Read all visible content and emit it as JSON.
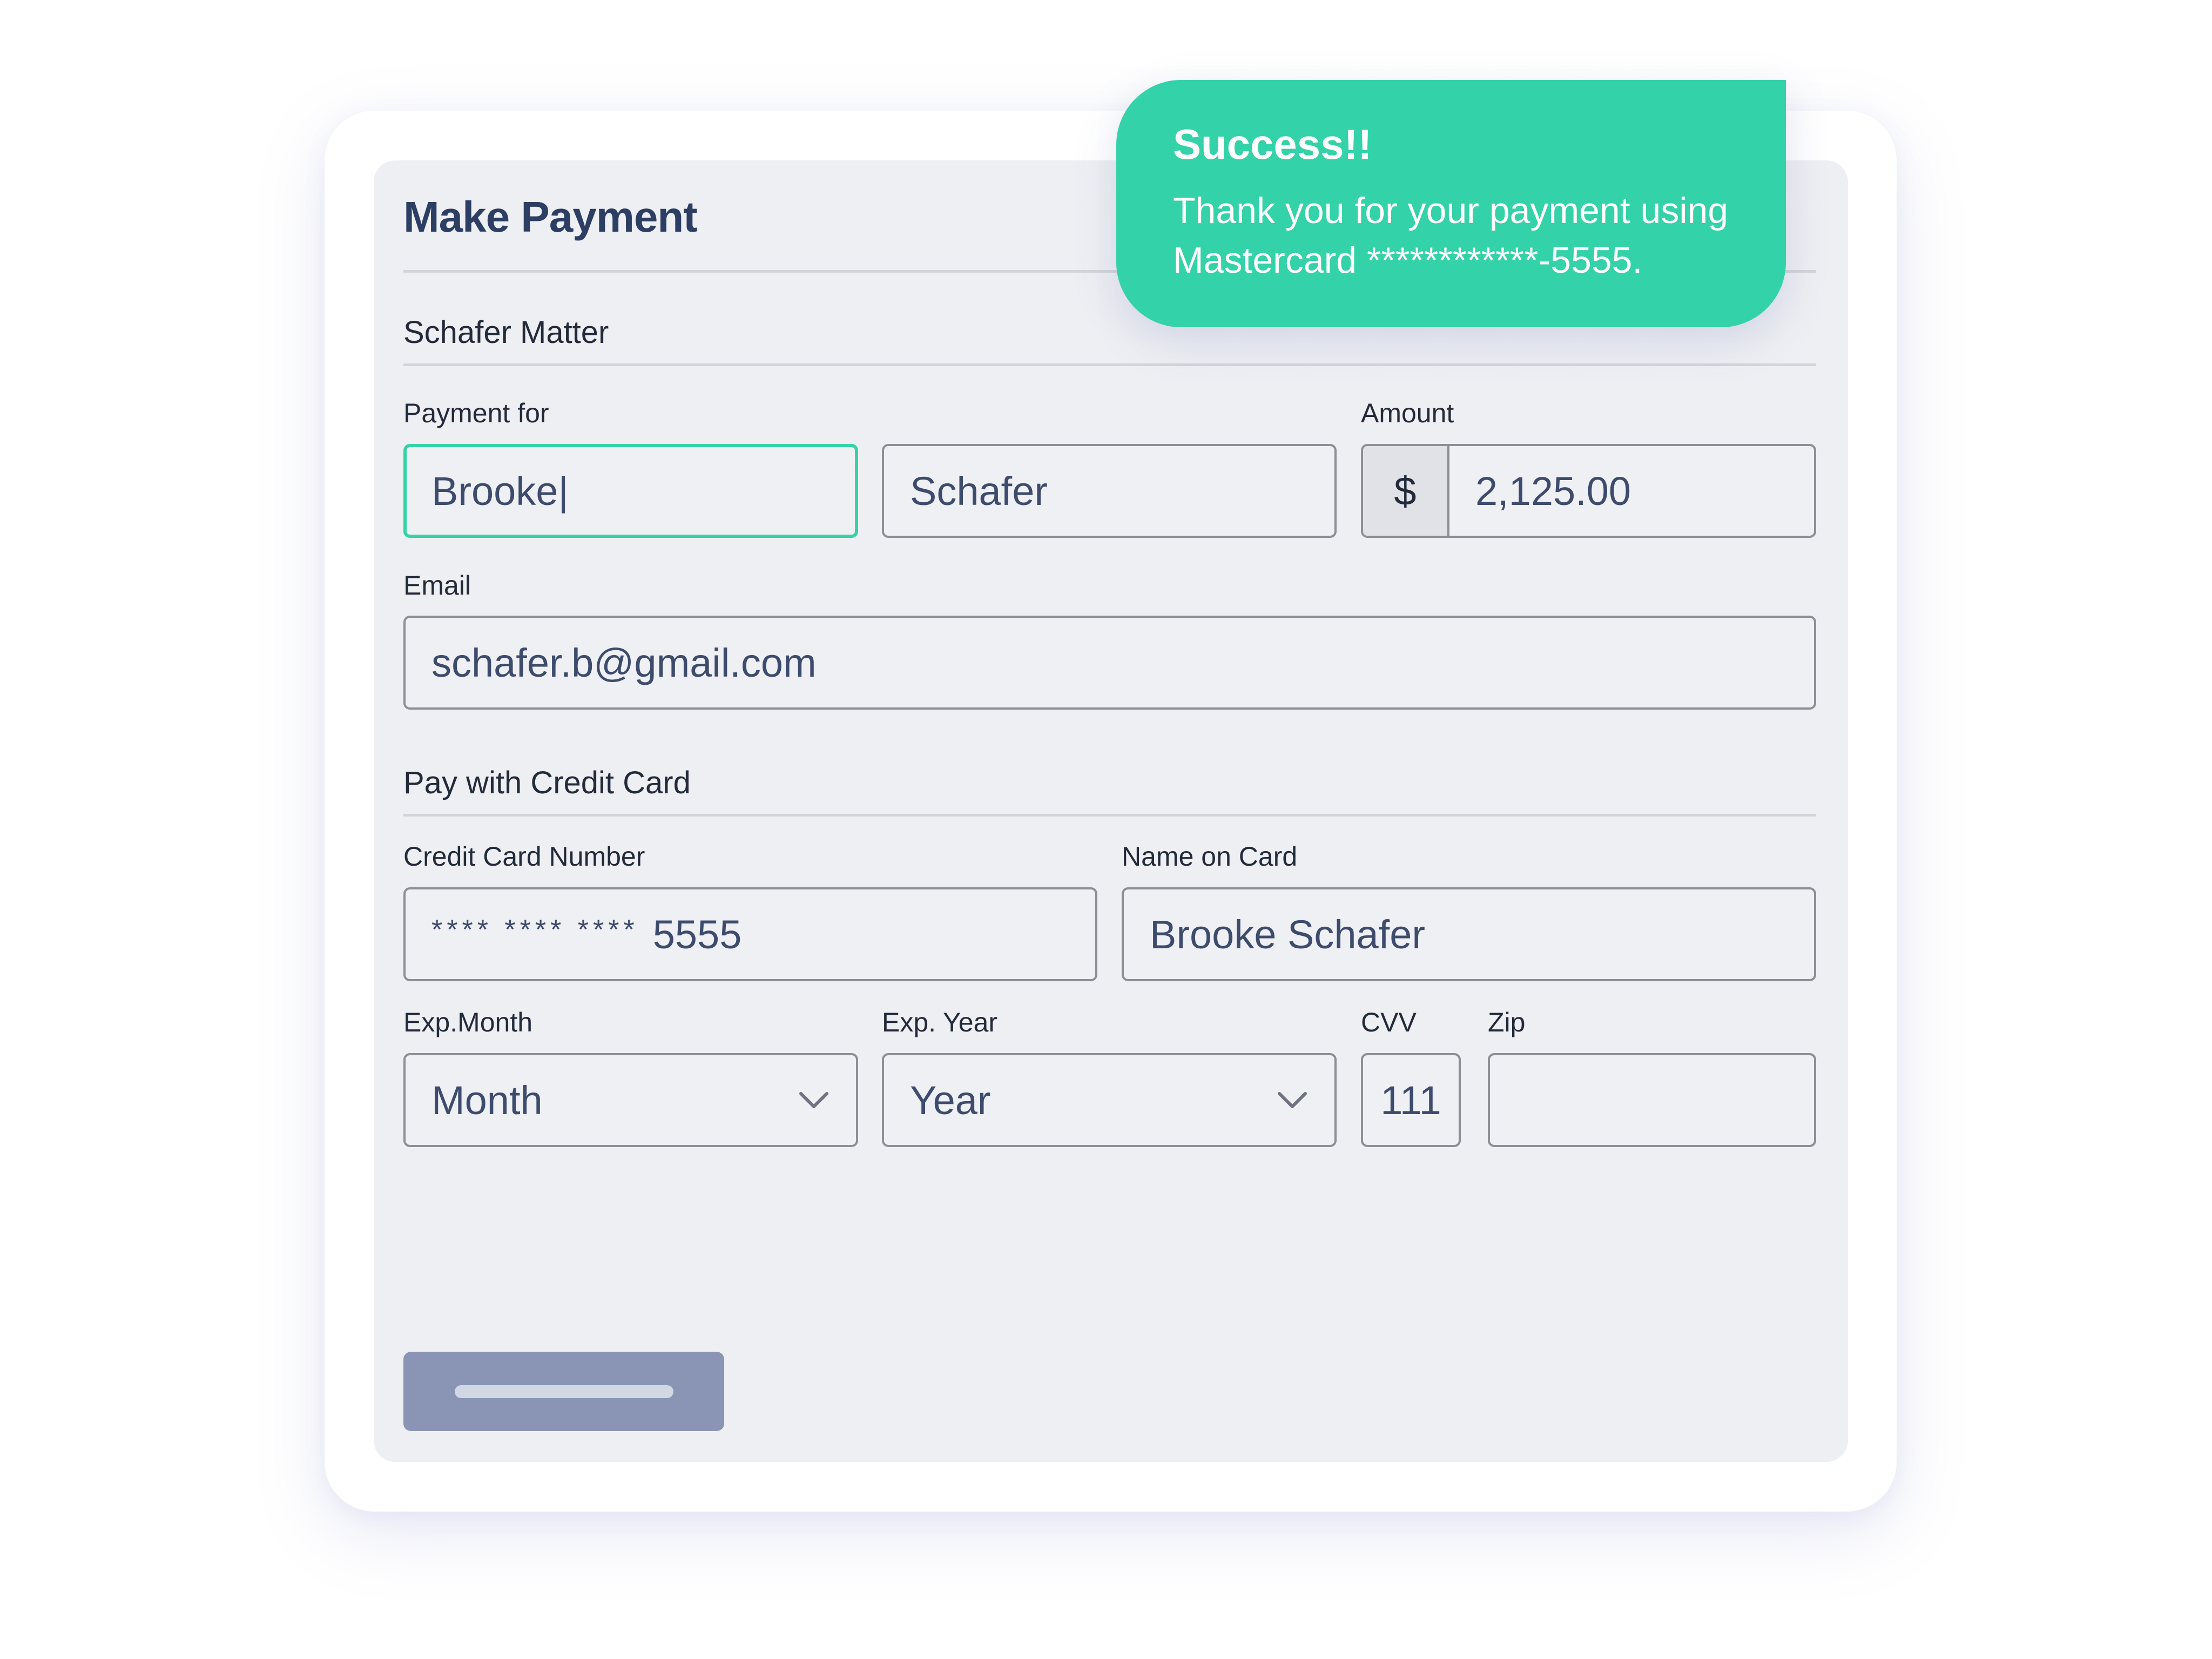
{
  "form": {
    "title": "Make Payment",
    "matter_section": "Schafer Matter",
    "payment_for_label": "Payment for",
    "first_name_value": "Brooke|",
    "last_name_value": "Schafer",
    "amount_label": "Amount",
    "currency_symbol": "$",
    "amount_value": "2,125.00",
    "email_label": "Email",
    "email_value": "schafer.b@gmail.com",
    "card_section": "Pay with Credit Card",
    "card_number_label": "Credit Card Number",
    "card_number_mask": "**** **** ****",
    "card_number_last4": "5555",
    "name_on_card_label": "Name on Card",
    "name_on_card_value": "Brooke Schafer",
    "exp_month_label": "Exp.Month",
    "exp_month_value": "Month",
    "exp_year_label": "Exp. Year",
    "exp_year_value": "Year",
    "cvv_label": "CVV",
    "cvv_value": "111",
    "zip_label": "Zip",
    "zip_value": ""
  },
  "toast": {
    "title": "Success!!",
    "message": "Thank you for your payment using Mastercard ************-5555.",
    "color": "#33d2a8"
  },
  "colors": {
    "focus_border": "#35d2a7",
    "heading": "#2c3e63",
    "button": "#8a95b5"
  },
  "icons": {
    "select_arrow": "chevron-down-icon"
  }
}
